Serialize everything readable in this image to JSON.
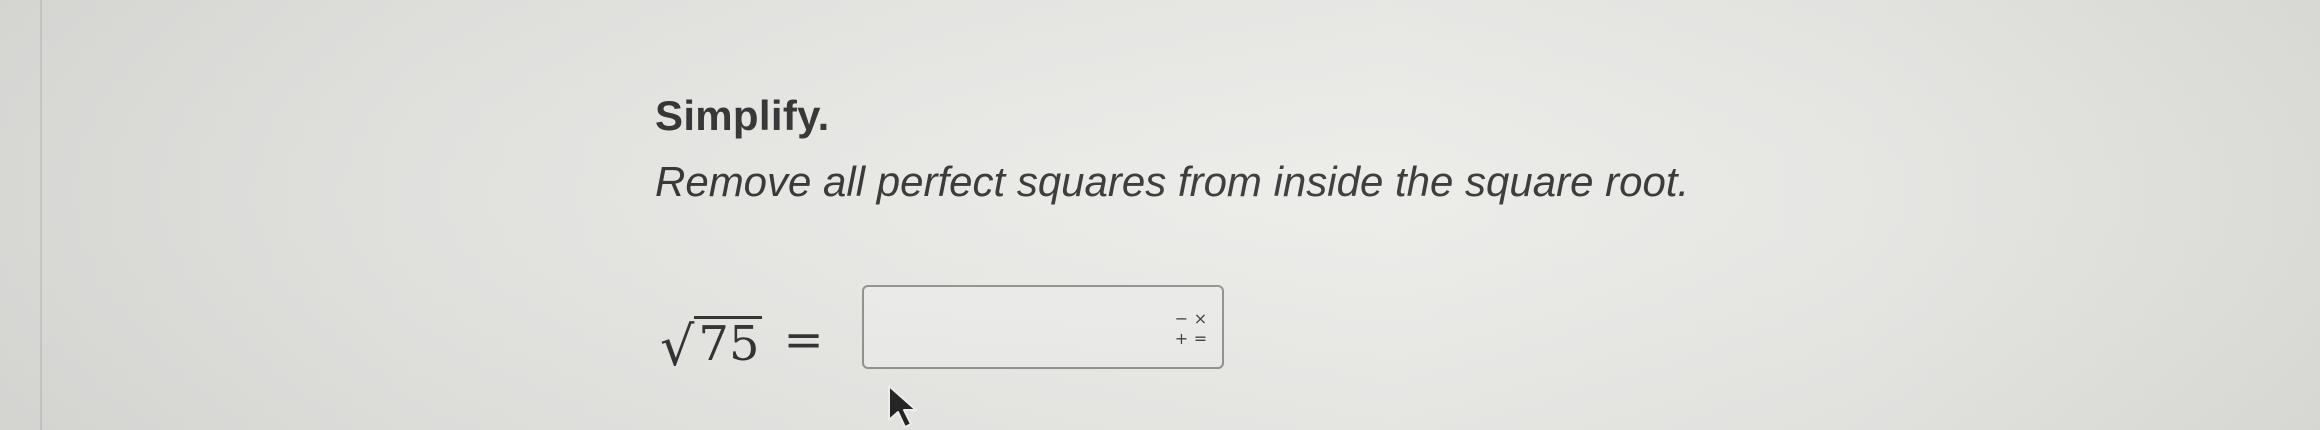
{
  "question": {
    "title": "Simplify.",
    "instruction": "Remove all perfect squares from inside the square root."
  },
  "equation": {
    "radical_sign": "√",
    "radicand": "75",
    "equals": "="
  },
  "answer": {
    "value": "",
    "keypad_symbols": [
      "−",
      "×",
      "+",
      "="
    ]
  },
  "icons": {
    "keypad": "math-keypad-icon",
    "cursor": "mouse-pointer-icon"
  }
}
